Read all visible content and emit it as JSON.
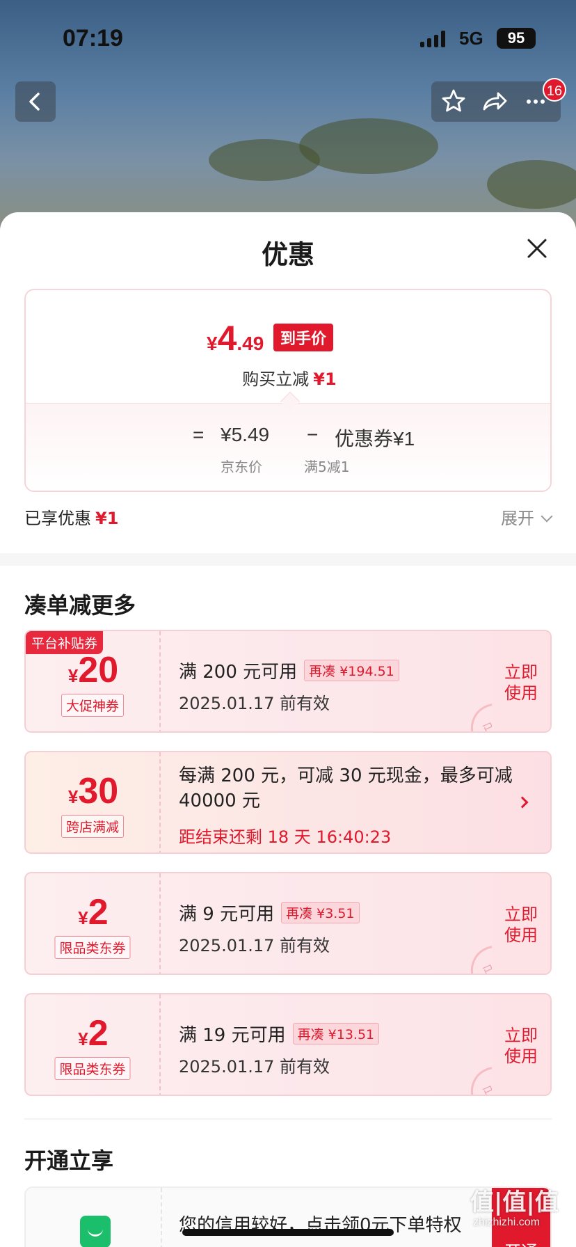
{
  "status_bar": {
    "time": "07:19",
    "network": "5G",
    "battery": "95"
  },
  "header": {
    "notification_count": "16"
  },
  "sheet": {
    "title": "优惠",
    "price": {
      "currency": "¥",
      "final_int": "4",
      "final_dec": ".49",
      "final_tag": "到手价",
      "direct_cut_label": "购买立减",
      "direct_cut_value": "¥1",
      "eq": "=",
      "jd_price": "¥5.49",
      "minus": "−",
      "coupon_deduct": "优惠券¥1",
      "jd_price_label": "京东价",
      "coupon_rule": "满5减1"
    },
    "enjoyed": {
      "label": "已享优惠",
      "value": "¥1",
      "expand": "展开"
    }
  },
  "section_more": {
    "title": "凑单减更多",
    "coupons": [
      {
        "corner": "平台补贴券",
        "symbol": "¥",
        "amount": "20",
        "type": "大促神券",
        "cond": "满 200 元可用",
        "addon": "再凑 ¥194.51",
        "date": "2025.01.17 前有效",
        "use": "立即\n使用",
        "stamp": "已领"
      },
      {
        "symbol": "¥",
        "amount": "30",
        "type": "跨店满减",
        "desc": "每满 200 元，可减 30 元现金，最多可减 40000 元",
        "countdown": "距结束还剩 18 天 16:40:23"
      },
      {
        "symbol": "¥",
        "amount": "2",
        "type": "限品类东券",
        "cond": "满 9 元可用",
        "addon": "再凑 ¥3.51",
        "date": "2025.01.17 前有效",
        "use": "立即\n使用",
        "stamp": "已领"
      },
      {
        "symbol": "¥",
        "amount": "2",
        "type": "限品类东券",
        "cond": "满 19 元可用",
        "addon": "再凑 ¥13.51",
        "date": "2025.01.17 前有效",
        "use": "立即\n使用",
        "stamp": "已领"
      }
    ]
  },
  "section_open": {
    "title": "开通立享",
    "card_text": "您的信用较好，点击领0元下单特权",
    "card_tag": "开通"
  },
  "watermark": {
    "main": "值|值|值",
    "sub": "zhizhizhi.com"
  }
}
